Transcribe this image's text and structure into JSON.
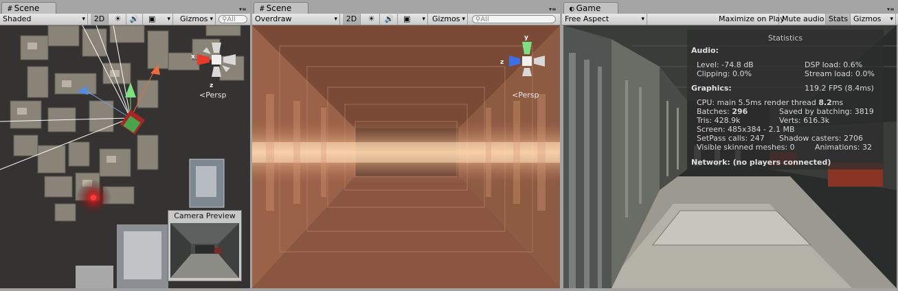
{
  "scene1": {
    "tab_title": "Scene",
    "shading_mode": "Shaded",
    "btn_2d": "2D",
    "gizmos_label": "Gizmos",
    "search_placeholder": "All",
    "persp_label": "Persp",
    "camera_preview_title": "Camera Preview",
    "axis_x": "x",
    "axis_z": "z"
  },
  "scene2": {
    "tab_title": "Scene",
    "shading_mode": "Overdraw",
    "btn_2d": "2D",
    "gizmos_label": "Gizmos",
    "search_placeholder": "All",
    "persp_label": "Persp",
    "axis_y": "y",
    "axis_z": "z"
  },
  "game": {
    "tab_title": "Game",
    "aspect": "Free Aspect",
    "maximize_on_play": "Maximize on Play",
    "mute_audio": "Mute audio",
    "stats_button": "Stats",
    "gizmos_label": "Gizmos"
  },
  "statistics": {
    "title": "Statistics",
    "audio_header": "Audio:",
    "level": "Level: -74.8 dB",
    "dsp_load": "DSP load: 0.6%",
    "clipping": "Clipping: 0.0%",
    "stream_load": "Stream load: 0.0%",
    "graphics_header": "Graphics:",
    "fps": "119.2 FPS (8.4ms)",
    "cpu": "CPU: main 5.5ms  render thread ",
    "cpu_render": "8.2",
    "cpu_unit": "ms",
    "batches_label": "Batches: ",
    "batches_value": "296",
    "saved_batching": "Saved by batching: 3819",
    "tris": "Tris: 428.9k",
    "verts": "Verts: 616.3k",
    "screen": "Screen: 485x384 - 2.1 MB",
    "setpass": "SetPass calls: 247",
    "shadow_casters": "Shadow casters: 2706",
    "skinned": "Visible skinned meshes: 0",
    "animations": "Animations: 32",
    "network": "Network: (no players connected)"
  }
}
